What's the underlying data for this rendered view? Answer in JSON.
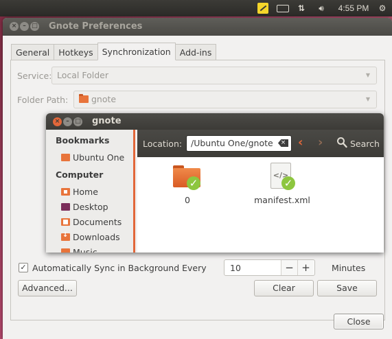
{
  "panel": {
    "clock": "4:55 PM",
    "icons": [
      "notes-indicator-icon",
      "keyboard-indicator-icon",
      "network-icon",
      "volume-icon",
      "gear-icon"
    ]
  },
  "prefs": {
    "title": "Gnote Preferences",
    "tabs": [
      {
        "label": "General"
      },
      {
        "label": "Hotkeys"
      },
      {
        "label": "Synchronization"
      },
      {
        "label": "Add-ins"
      }
    ],
    "active_tab": "Synchronization",
    "service_label": "Service:",
    "service_value": "Local Folder",
    "folder_label": "Folder Path:",
    "folder_value": "gnote",
    "autosync_label": "Automatically Sync in Background Every",
    "autosync_checked": true,
    "autosync_value": "10",
    "minus": "−",
    "plus": "+",
    "minutes_label": "Minutes",
    "advanced_button": "Advanced...",
    "clear_button": "Clear",
    "save_button": "Save",
    "close_button": "Close"
  },
  "chooser": {
    "title": "gnote",
    "bookmarks_header": "Bookmarks",
    "bookmarks": [
      {
        "label": "Ubuntu One",
        "icon": "folder-icon"
      }
    ],
    "computer_header": "Computer",
    "places": [
      {
        "label": "Home",
        "icon": "home-folder-icon"
      },
      {
        "label": "Desktop",
        "icon": "desktop-icon"
      },
      {
        "label": "Documents",
        "icon": "documents-folder-icon"
      },
      {
        "label": "Downloads",
        "icon": "downloads-folder-icon"
      },
      {
        "label": "Music",
        "icon": "music-folder-icon"
      }
    ],
    "location_label": "Location:",
    "location_value": "/Ubuntu One/gnote",
    "search_label": "Search",
    "files": [
      {
        "name": "0",
        "type": "folder",
        "synced": true
      },
      {
        "name": "manifest.xml",
        "type": "xml-file",
        "synced": true
      }
    ]
  },
  "colors": {
    "accent": "#e2673a",
    "panel": "#3c3b37",
    "sync_check": "#8dc63f"
  }
}
